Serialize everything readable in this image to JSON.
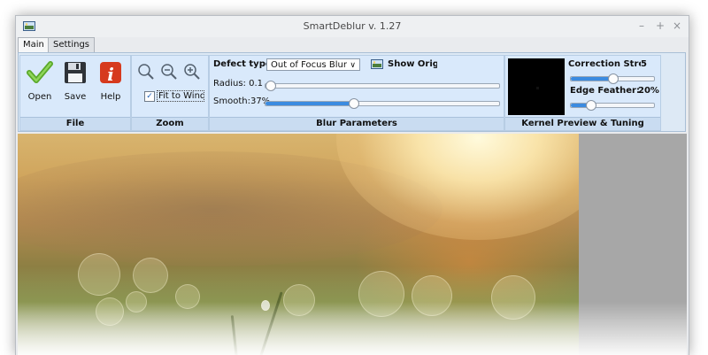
{
  "window": {
    "title": "SmartDeblur v. 1.27",
    "controls": {
      "minimize": "–",
      "maximize": "+",
      "close": "×"
    }
  },
  "tabs": [
    {
      "label": "Main",
      "active": true
    },
    {
      "label": "Settings",
      "active": false
    }
  ],
  "ribbon": {
    "file": {
      "label": "File",
      "open_label": "Open",
      "save_label": "Save",
      "help_label": "Help"
    },
    "zoom": {
      "label": "Zoom",
      "fit_label": "Fit to Windc",
      "fit_checked": true
    },
    "blur": {
      "label": "Blur Parameters",
      "defect_type_label": "Defect type:",
      "defect_type_value": "Out of Focus Blur",
      "show_original_label": "Show Origina",
      "radius_label": "Radius:",
      "radius_value": "0.1",
      "radius_position": 0.0,
      "smooth_label": "Smooth:",
      "smooth_value": "37%",
      "smooth_position": 0.37
    },
    "kernel": {
      "label": "Kernel Preview & Tuning",
      "correction_label": "Correction Streng",
      "correction_value": "5",
      "correction_position": 0.5,
      "edge_label": "Edge Feather:",
      "edge_value": "20%",
      "edge_position": 0.2
    }
  },
  "colors": {
    "accent": "#3b8be0",
    "ribbon_bg": "#d9e9fb",
    "help_icon": "#d63a1e",
    "check_icon": "#6dbb2f"
  }
}
